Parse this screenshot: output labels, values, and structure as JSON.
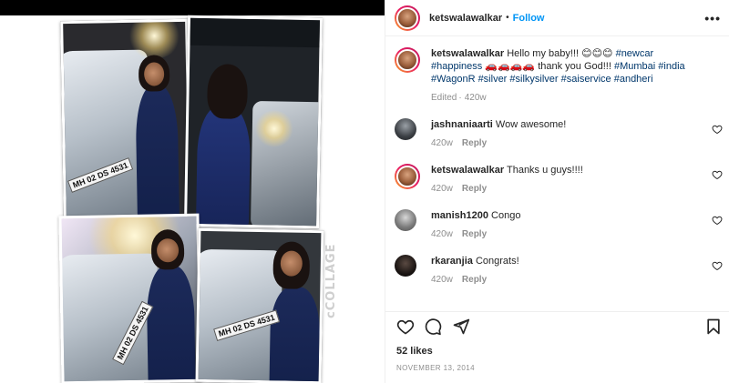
{
  "post": {
    "username": "ketswalawalkar",
    "separator": "•",
    "follow_label": "Follow",
    "more_label": "•••"
  },
  "media": {
    "plates": [
      "MH 02 DS 4531",
      "MH 02 DS 4531",
      "MH 02 DS 4531"
    ],
    "watermark": "cCOLLAGE"
  },
  "caption": {
    "username": "ketswalawalkar",
    "text_1": "Hello my baby!!! ",
    "emoji_1": "😊😊😊",
    "tags_1": " #newcar #happiness",
    "emoji_2": "🚗🚗🚗🚗",
    "text_2": " thank you God!!! ",
    "tags_2": "#Mumbai #india #WagonR #silver #silkysilver #saiservice #andheri",
    "edited": "Edited",
    "age": "420w"
  },
  "comments": [
    {
      "username": "jashnaniaarti",
      "text": "Wow awesome!",
      "age": "420w",
      "reply": "Reply"
    },
    {
      "username": "ketswalawalkar",
      "text": "Thanks u guys!!!!",
      "age": "420w",
      "reply": "Reply"
    },
    {
      "username": "manish1200",
      "text": "Congo",
      "age": "420w",
      "reply": "Reply"
    },
    {
      "username": "rkaranjia",
      "text": "Congrats!",
      "age": "420w",
      "reply": "Reply"
    }
  ],
  "actions": {
    "likes": "52 likes",
    "date": "NOVEMBER 13, 2014"
  }
}
